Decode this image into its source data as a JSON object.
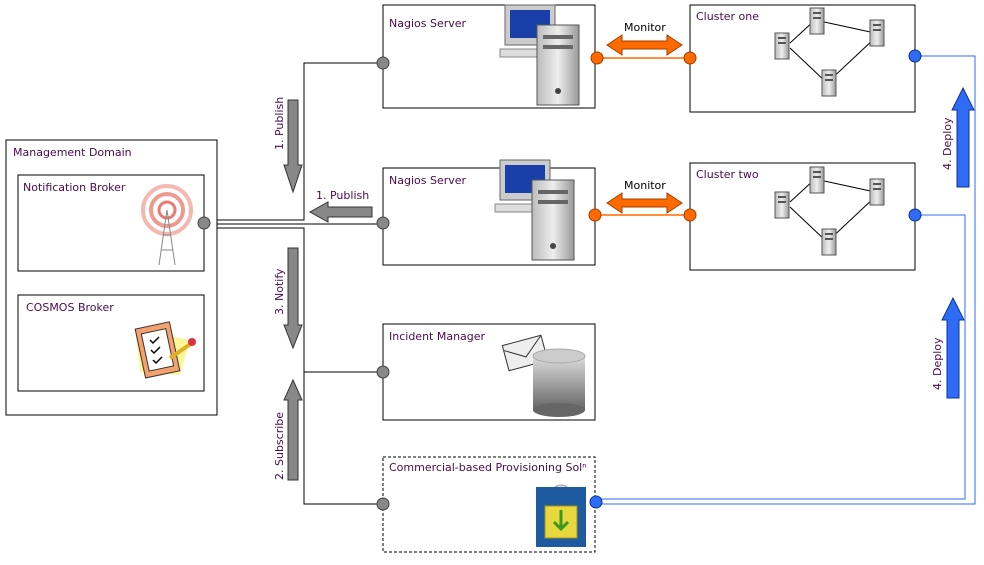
{
  "colors": {
    "accent_orange": "#ff6a00",
    "accent_blue": "#2f6cf5",
    "arrow_gray": "#888888",
    "label_purple": "#4a0a4e"
  },
  "management": {
    "title": "Management Domain",
    "notification_broker": "Notification Broker",
    "cosmos_broker": "COSMOS Broker",
    "icons": [
      "radio-tower-icon",
      "clipboard-checklist-icon"
    ]
  },
  "nodes": {
    "nagios1": "Nagios Server",
    "nagios2": "Nagios Server",
    "cluster1": "Cluster one",
    "cluster2": "Cluster two",
    "incident": "Incident Manager",
    "provisioning": "Commercial-based Provisioning Solⁿ"
  },
  "arrows": {
    "publish_down": "1. Publish",
    "publish_left": "1. Publish",
    "notify": "3. Notify",
    "subscribe": "2. Subscribe",
    "monitor1": "Monitor",
    "monitor2": "Monitor",
    "deploy1": "4. Deploy",
    "deploy2": "4. Deploy"
  }
}
